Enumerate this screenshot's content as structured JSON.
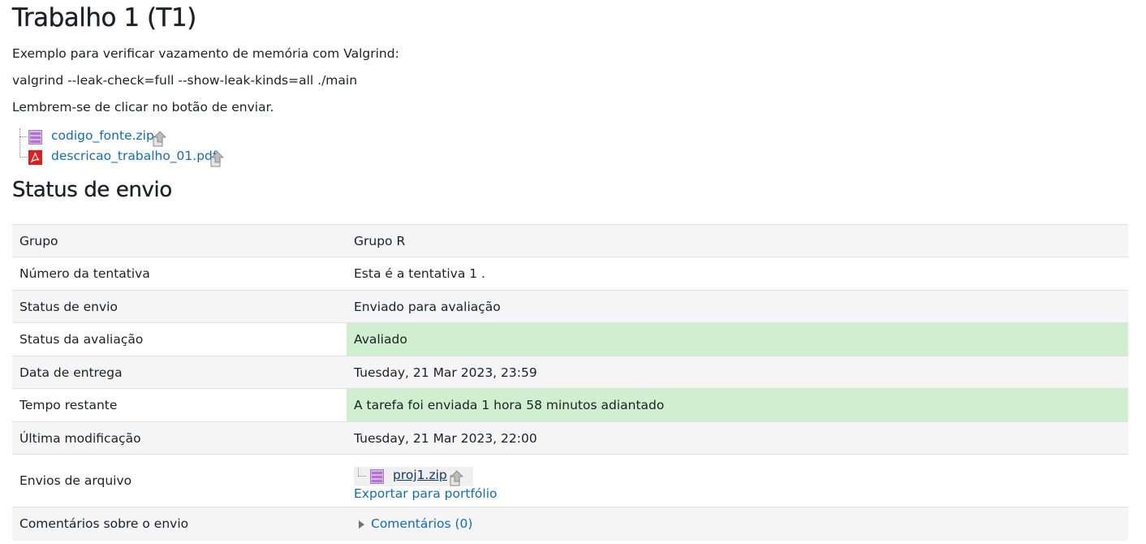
{
  "page": {
    "title": "Trabalho 1 (T1)",
    "intro": [
      "Exemplo para verificar vazamento de memória com Valgrind:",
      "valgrind --leak-check=full --show-leak-kinds=all ./main",
      "Lembrem-se de clicar no botão de enviar."
    ],
    "files": [
      {
        "name": "codigo_fonte.zip",
        "icon": "zip-file-icon"
      },
      {
        "name": "descricao_trabalho_01.pdf",
        "icon": "pdf-file-icon"
      }
    ],
    "status_heading": "Status de envio"
  },
  "status_table": {
    "rows": [
      {
        "label": "Grupo",
        "value": "Grupo R"
      },
      {
        "label": "Número da tentativa",
        "value": "Esta é a tentativa 1 ."
      },
      {
        "label": "Status de envio",
        "value": "Enviado para avaliação"
      },
      {
        "label": "Status da avaliação",
        "value": "Avaliado"
      },
      {
        "label": "Data de entrega",
        "value": "Tuesday, 21 Mar 2023, 23:59"
      },
      {
        "label": "Tempo restante",
        "value": "A tarefa foi enviada 1 hora 58 minutos adiantado"
      },
      {
        "label": "Última modificação",
        "value": "Tuesday, 21 Mar 2023, 22:00"
      },
      {
        "label": "Envios de arquivo",
        "file": "proj1.zip",
        "export_link": "Exportar para portfólio"
      },
      {
        "label": "Comentários sobre o envio",
        "comments_link": "Comentários (0)"
      }
    ]
  },
  "colors": {
    "link": "#0f6cbf",
    "success_bg": "#cfefd0",
    "stripe_bg": "#f5f5f5"
  }
}
